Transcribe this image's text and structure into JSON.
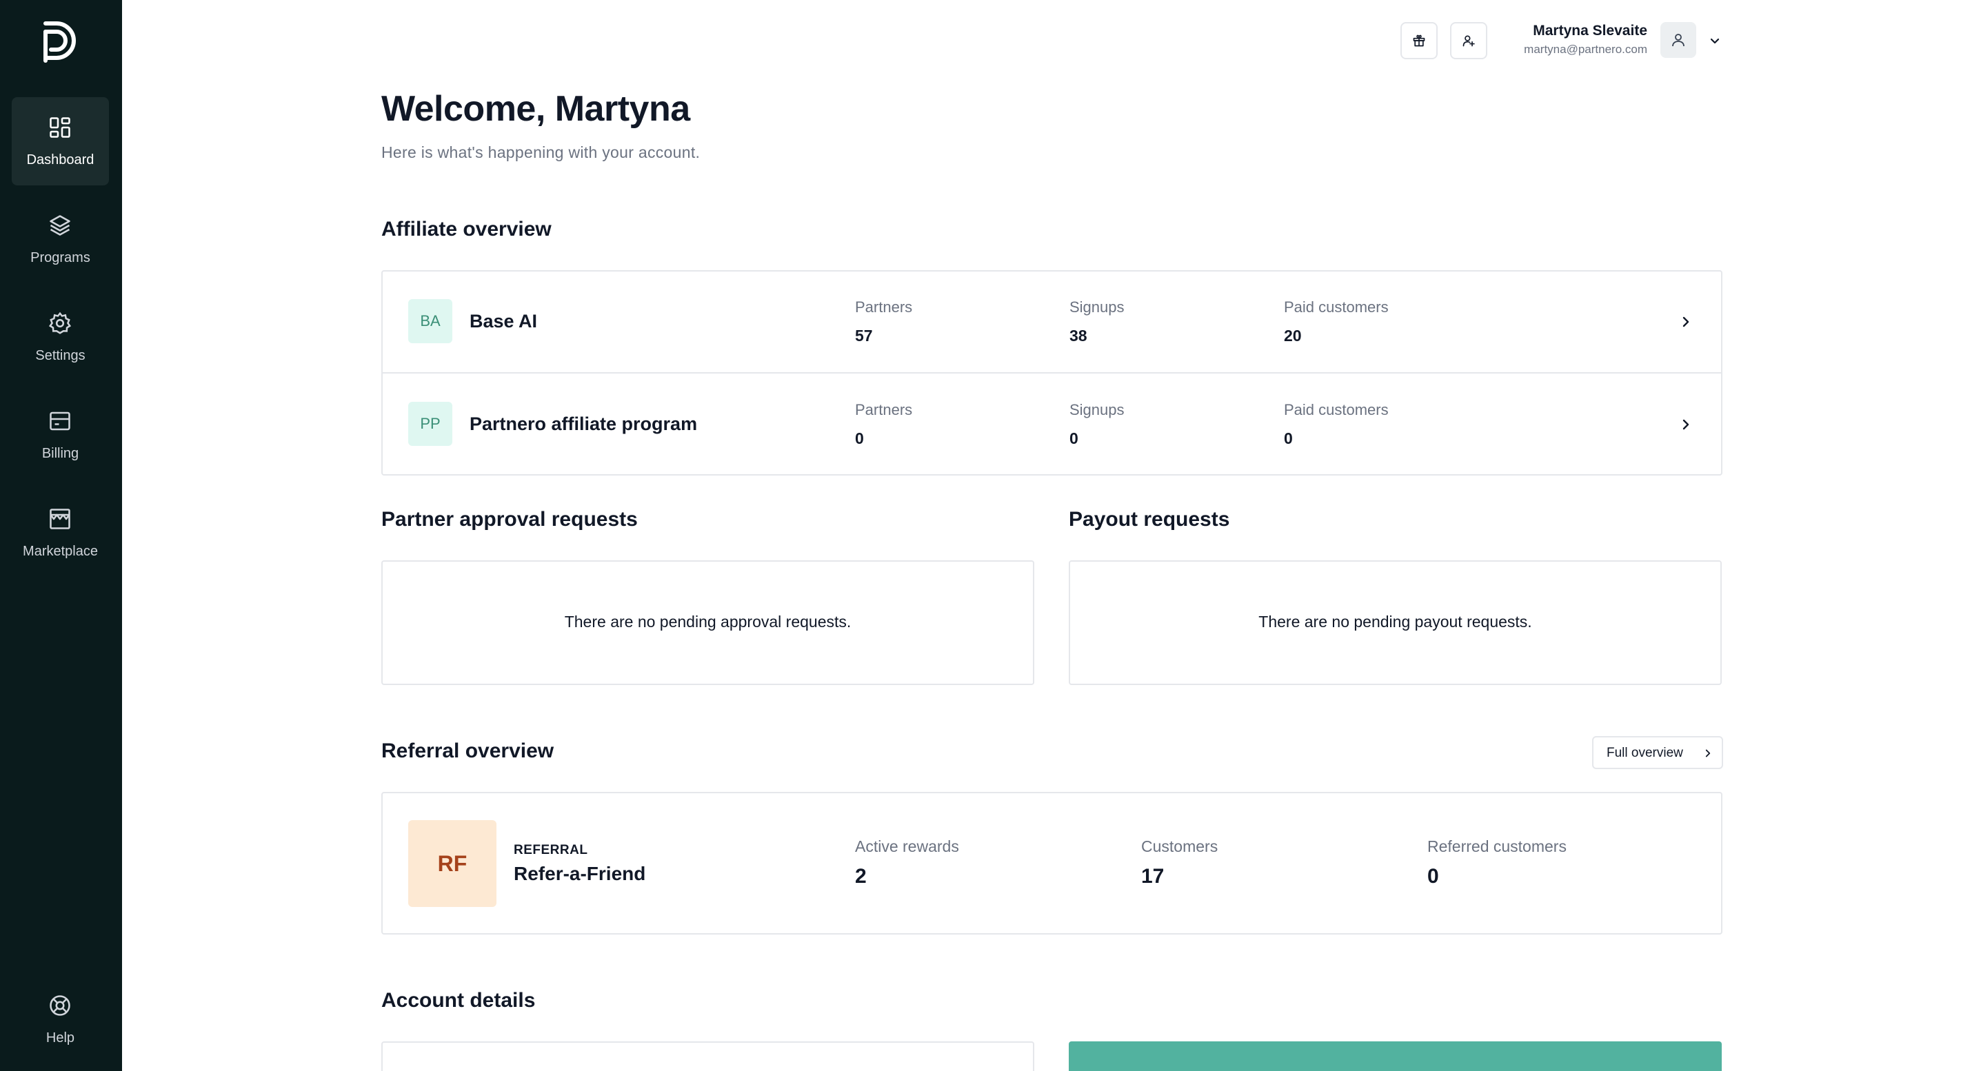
{
  "sidebar": {
    "items": [
      {
        "label": "Dashboard",
        "icon": "dashboard-icon",
        "active": true
      },
      {
        "label": "Programs",
        "icon": "layers-icon"
      },
      {
        "label": "Settings",
        "icon": "gear-icon"
      },
      {
        "label": "Billing",
        "icon": "billing-icon"
      },
      {
        "label": "Marketplace",
        "icon": "store-icon"
      }
    ],
    "help": {
      "label": "Help",
      "icon": "lifebuoy-icon"
    }
  },
  "topbar": {
    "user_name": "Martyna Slevaite",
    "user_email": "martyna@partnero.com"
  },
  "welcome": {
    "title": "Welcome, Martyna",
    "subtitle": "Here is what's happening with your account."
  },
  "affiliate": {
    "title": "Affiliate overview",
    "programs": [
      {
        "initials": "BA",
        "name": "Base AI",
        "partners_label": "Partners",
        "partners": "57",
        "signups_label": "Signups",
        "signups": "38",
        "paid_label": "Paid customers",
        "paid": "20"
      },
      {
        "initials": "PP",
        "name": "Partnero affiliate program",
        "partners_label": "Partners",
        "partners": "0",
        "signups_label": "Signups",
        "signups": "0",
        "paid_label": "Paid customers",
        "paid": "0"
      }
    ]
  },
  "approvals": {
    "title": "Partner approval requests",
    "empty": "There are no pending approval requests."
  },
  "payouts": {
    "title": "Payout requests",
    "empty": "There are no pending payout requests."
  },
  "referral": {
    "title": "Referral overview",
    "full_overview_label": "Full overview",
    "program": {
      "initials": "RF",
      "kicker": "REFERRAL",
      "name": "Refer-a-Friend",
      "active_rewards_label": "Active rewards",
      "active_rewards": "2",
      "customers_label": "Customers",
      "customers": "17",
      "referred_label": "Referred customers",
      "referred": "0"
    }
  },
  "account": {
    "title": "Account details"
  },
  "colors": {
    "sidebar_bg": "#0a1b1c",
    "accent": "#52b29f",
    "badge_bg": "#dff7f1",
    "referral_badge_bg": "#fde9d3"
  }
}
